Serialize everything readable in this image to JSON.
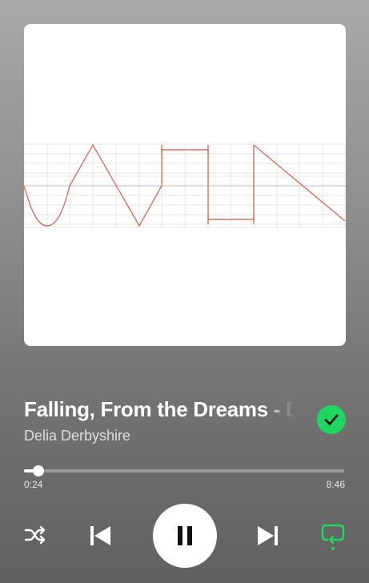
{
  "track": {
    "title": "Falling, From the Dreams - Delia Derbyshire",
    "artist": "Delia Derbyshire",
    "liked": true
  },
  "playback": {
    "elapsed": "0:24",
    "total": "8:46",
    "progress_fraction": 0.046,
    "state": "playing"
  },
  "controls": {
    "shuffle_icon": "shuffle-icon",
    "previous_icon": "skip-previous-icon",
    "play_pause_icon": "pause-icon",
    "next_icon": "skip-next-icon",
    "repeat_icon": "repeat-one-icon"
  },
  "artwork": {
    "description_icon": "waveform-art",
    "wave_color": "#d9705f"
  },
  "colors": {
    "accent": "#1ed760",
    "background_top": "#a9a9a9",
    "background_bottom": "#606060"
  }
}
